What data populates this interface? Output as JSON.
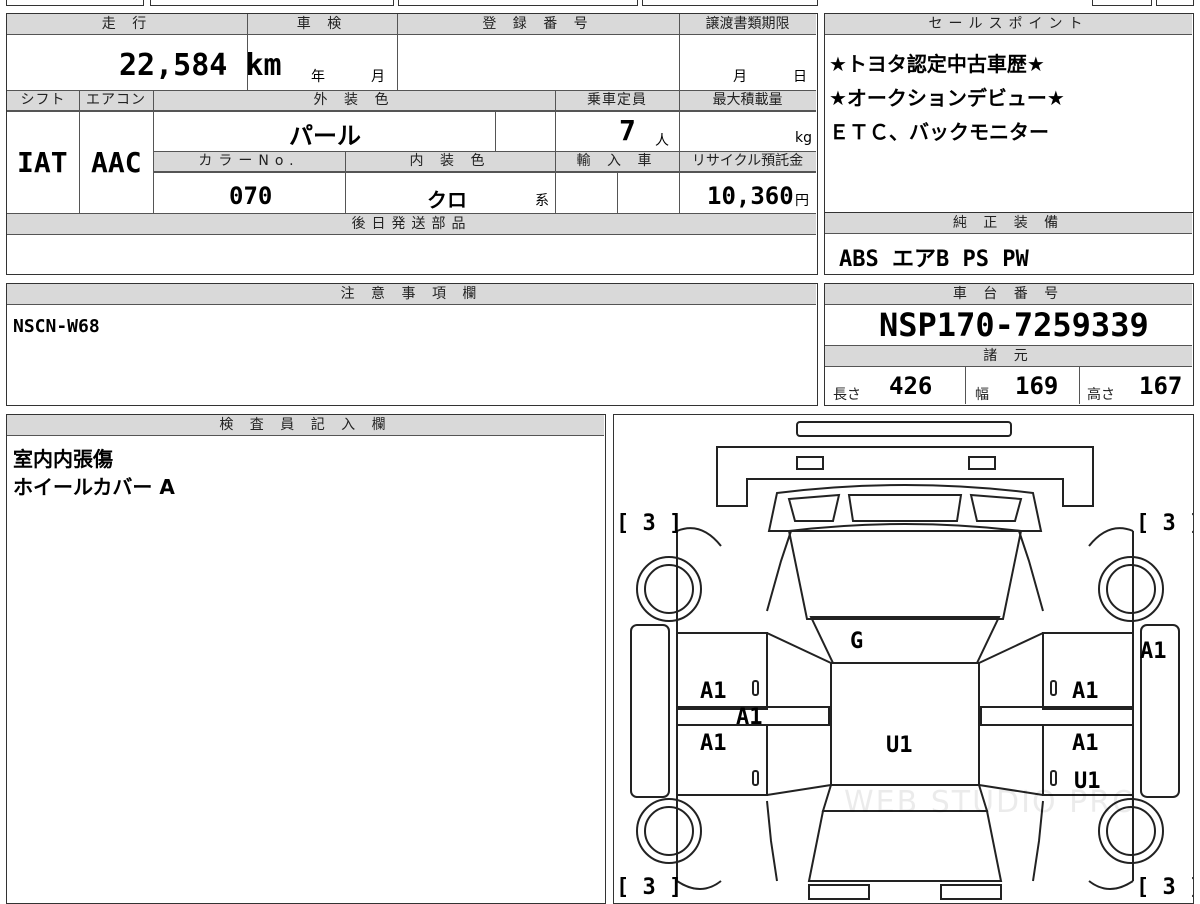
{
  "top_header": {
    "mileage_label": "走 行",
    "inspection_label": "車 検",
    "registration_label": "登 録 番 号",
    "transfer_doc_label": "譲渡書類期限",
    "sales_point_label": "セールスポイント"
  },
  "mileage": "22,584 km",
  "inspection": {
    "year_unit": "年",
    "month_unit": "月"
  },
  "registration_number": "",
  "transfer_deadline": {
    "month_unit": "月",
    "day_unit": "日"
  },
  "row2_labels": {
    "shift": "シフト",
    "aircon": "エアコン",
    "exterior_color": "外 装 色",
    "capacity": "乗車定員",
    "max_load": "最大積載量"
  },
  "shift": "IAT",
  "aircon": "AAC",
  "exterior_color": "パール",
  "capacity": {
    "value": "7",
    "unit": "人"
  },
  "max_load": {
    "value": "",
    "unit": "kg"
  },
  "row3_labels": {
    "color_no": "カラーNo.",
    "interior_color": "内 装 色",
    "imported": "輸 入 車",
    "recycle": "リサイクル預託金"
  },
  "color_no": "070",
  "interior_color": {
    "value": "クロ",
    "suffix": "系"
  },
  "recycle_fee": {
    "value": "10,360",
    "unit": "円"
  },
  "later_parts_label": "後日発送部品",
  "later_parts": "",
  "sales_points": [
    "★トヨタ認定中古車歴★",
    "★オークションデビュー★",
    "ＥＴＣ、バックモニター"
  ],
  "genuine_equipment_label": "純 正 装 備",
  "genuine_equipment": "ABS エアB PS PW",
  "notes_label": "注 意 事 項 欄",
  "notes": "NSCN-W68",
  "chassis_label": "車 台 番 号",
  "chassis_number": "NSP170-7259339",
  "specs_label": "諸 元",
  "specs": {
    "length_label": "長さ",
    "length": "426",
    "width_label": "幅",
    "width": "169",
    "height_label": "高さ",
    "height": "167"
  },
  "inspector_label": "検 査 員 記 入 欄",
  "inspector_notes": [
    "室内内張傷",
    "ホイールカバー A"
  ],
  "tire_marks": {
    "front_left": "[ 3 ]",
    "front_right": "[ 3 ]",
    "rear_left": "[ 3 ]",
    "rear_right": "[ 3 ]"
  },
  "damage_marks": {
    "hood": "G",
    "roof": "U1",
    "left_front_door": "A1",
    "left_center": "A1",
    "left_rear_door": "A1",
    "right_front_door": "A1",
    "right_rear_door": "A1",
    "right_rear_lower": "U1",
    "right_fender": "A1"
  },
  "watermark": "WEB STUDIO PRO"
}
